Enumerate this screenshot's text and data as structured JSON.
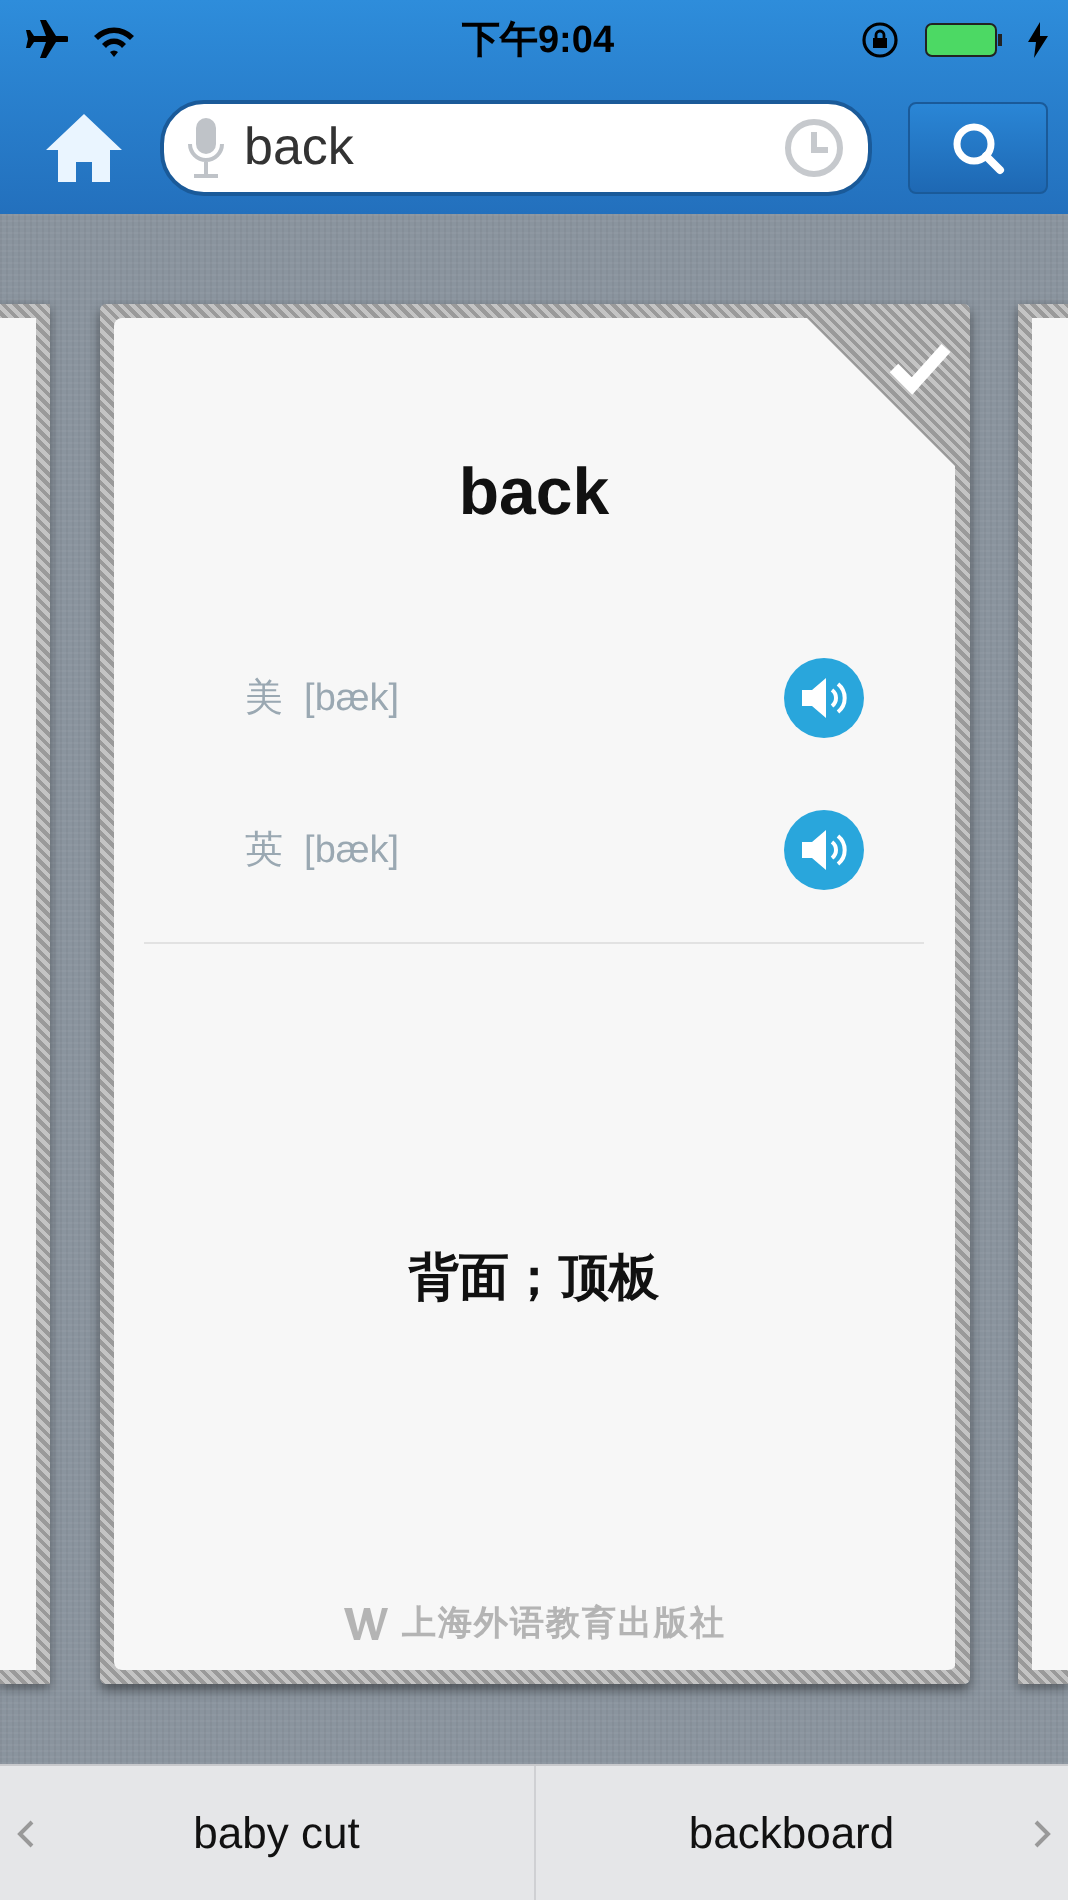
{
  "status_bar": {
    "time": "下午9:04"
  },
  "search": {
    "value": "back"
  },
  "card": {
    "word": "back",
    "learned": true,
    "pronunciations": [
      {
        "region": "美",
        "phonetic": "[bæk]"
      },
      {
        "region": "英",
        "phonetic": "[bæk]"
      }
    ],
    "meaning": "背面；顶板",
    "publisher": "上海外语教育出版社"
  },
  "nav": {
    "previous": "baby cut",
    "next": "backboard"
  }
}
